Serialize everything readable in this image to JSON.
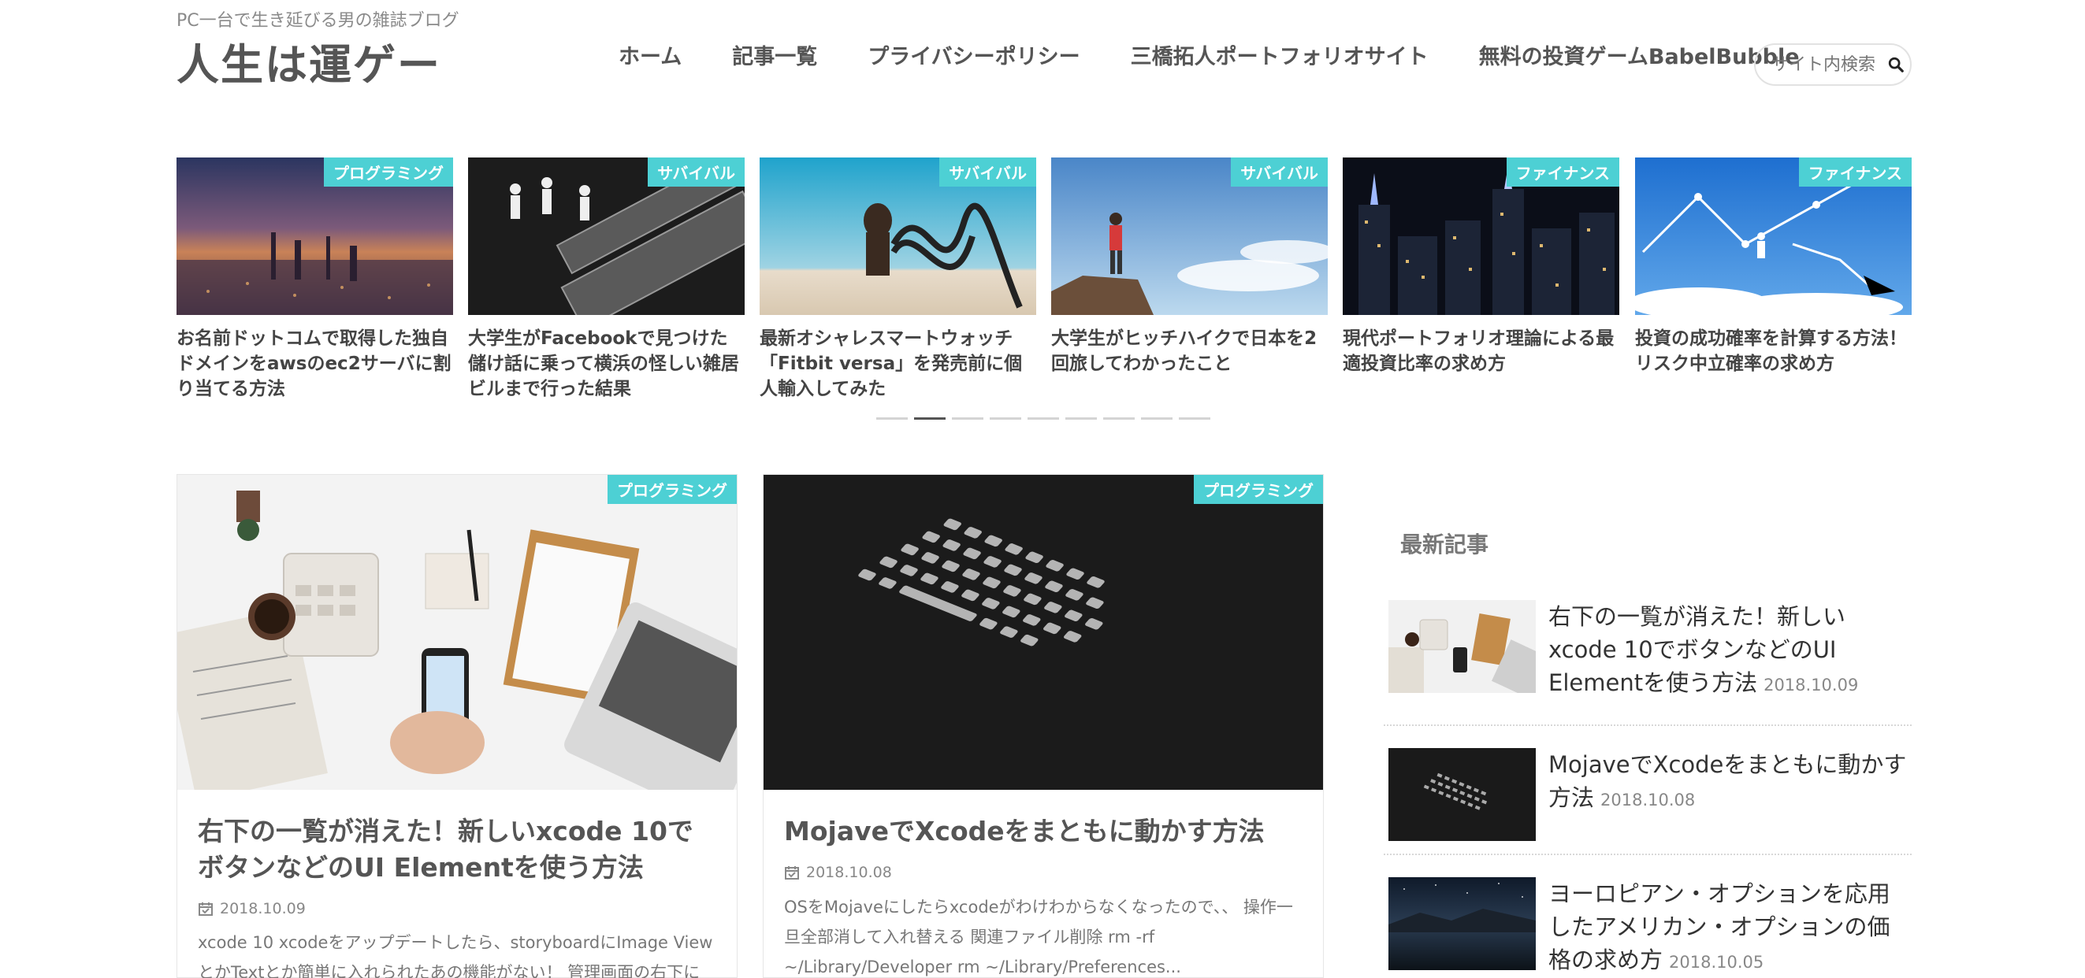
{
  "header": {
    "tagline": "PC一台で生き延びる男の雑誌ブログ",
    "title": "人生は運ゲー",
    "nav": [
      "ホーム",
      "記事一覧",
      "プライバシーポリシー",
      "三橋拓人ポートフォリオサイト",
      "無料の投資ゲームBabelBubble"
    ],
    "search_placeholder": "サイト内検索"
  },
  "slider": {
    "slides": [
      {
        "category": "プログラミング",
        "title": "お名前ドットコムで取得した独自ドメインをawsのec2サーバに割り当てる方法"
      },
      {
        "category": "サバイバル",
        "title": "大学生がFacebookで見つけた儲け話に乗って横浜の怪しい雑居ビルまで行った結果"
      },
      {
        "category": "サバイバル",
        "title": "最新オシャレスマートウォッチ「Fitbit versa」を発売前に個人輸入してみた"
      },
      {
        "category": "サバイバル",
        "title": "大学生がヒッチハイクで日本を2回旅してわかったこと"
      },
      {
        "category": "ファイナンス",
        "title": "現代ポートフォリオ理論による最適投資比率の求め方"
      },
      {
        "category": "ファイナンス",
        "title": "投資の成功確率を計算する方法！リスク中立確率の求め方"
      }
    ],
    "active_dot": 2,
    "dot_count": 9
  },
  "cards": [
    {
      "category": "プログラミング",
      "title": "右下の一覧が消えた！新しいxcode 10でボタンなどのUI Elementを使う方法",
      "date": "2018.10.09",
      "excerpt": "xcode 10 xcodeをアップデートしたら、storyboardにImage ViewとかTextとか簡単に入れられたあの機能がない！ 管理画面の右下に"
    },
    {
      "category": "プログラミング",
      "title": "MojaveでXcodeをまともに動かす方法",
      "date": "2018.10.08",
      "excerpt": "OSをMojaveにしたらxcodeがわけわからなくなったので、、 操作一旦全部消して入れ替える 関連ファイル削除 rm -rf ~/Library/Developer rm ~/Library/Preferences..."
    }
  ],
  "sidebar": {
    "heading": "最新記事",
    "items": [
      {
        "title": "右下の一覧が消えた！新しいxcode 10でボタンなどのUI Elementを使う方法",
        "date": "2018.10.09"
      },
      {
        "title": "MojaveでXcodeをまともに動かす方法",
        "date": "2018.10.08"
      },
      {
        "title": "ヨーロピアン・オプションを応用したアメリカン・オプションの価格の求め方",
        "date": "2018.10.05"
      }
    ]
  },
  "colors": {
    "accent": "#4dd0d4",
    "text": "#444444"
  }
}
